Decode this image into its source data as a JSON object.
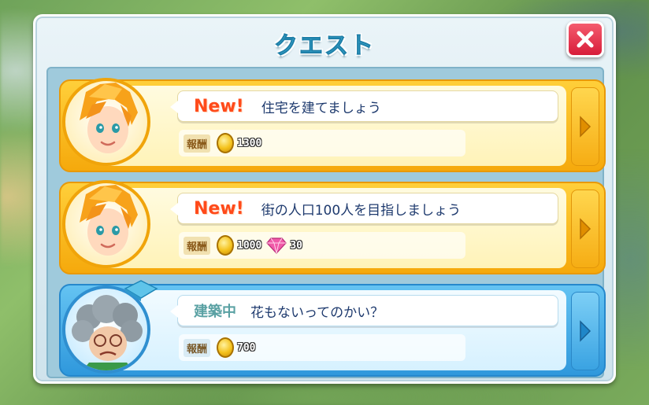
{
  "dialog": {
    "title": "クエスト"
  },
  "reward_label": "報酬",
  "quests": [
    {
      "tag": "New!",
      "text": "住宅を建てましょう",
      "rewards": [
        {
          "icon": "coin-icon",
          "amount": "1300"
        }
      ],
      "theme": "gold"
    },
    {
      "tag": "New!",
      "text": "街の人口100人を目指しましょう",
      "rewards": [
        {
          "icon": "coin-icon",
          "amount": "1000"
        },
        {
          "icon": "gem-icon",
          "amount": "30"
        }
      ],
      "theme": "gold"
    },
    {
      "tag": "建築中",
      "text": "花もないってのかい？",
      "rewards": [
        {
          "icon": "coin-icon",
          "amount": "700"
        }
      ],
      "theme": "blue"
    }
  ],
  "colors": {
    "title": "#3fb3d8",
    "new_tag": "#ff4a1a",
    "status_tag": "#5aa1a3",
    "close_button": "#e0283f",
    "gold_card": "#f7b51c",
    "blue_card": "#3aa3e2"
  }
}
